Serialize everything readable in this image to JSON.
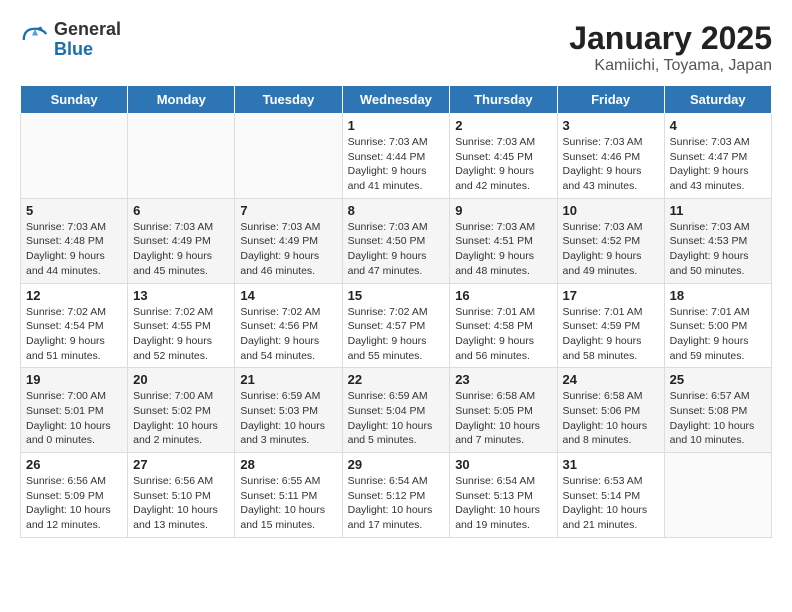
{
  "logo": {
    "general": "General",
    "blue": "Blue"
  },
  "title": "January 2025",
  "subtitle": "Kamiichi, Toyama, Japan",
  "weekdays": [
    "Sunday",
    "Monday",
    "Tuesday",
    "Wednesday",
    "Thursday",
    "Friday",
    "Saturday"
  ],
  "weeks": [
    [
      {
        "day": "",
        "info": ""
      },
      {
        "day": "",
        "info": ""
      },
      {
        "day": "",
        "info": ""
      },
      {
        "day": "1",
        "info": "Sunrise: 7:03 AM\nSunset: 4:44 PM\nDaylight: 9 hours and 41 minutes."
      },
      {
        "day": "2",
        "info": "Sunrise: 7:03 AM\nSunset: 4:45 PM\nDaylight: 9 hours and 42 minutes."
      },
      {
        "day": "3",
        "info": "Sunrise: 7:03 AM\nSunset: 4:46 PM\nDaylight: 9 hours and 43 minutes."
      },
      {
        "day": "4",
        "info": "Sunrise: 7:03 AM\nSunset: 4:47 PM\nDaylight: 9 hours and 43 minutes."
      }
    ],
    [
      {
        "day": "5",
        "info": "Sunrise: 7:03 AM\nSunset: 4:48 PM\nDaylight: 9 hours and 44 minutes."
      },
      {
        "day": "6",
        "info": "Sunrise: 7:03 AM\nSunset: 4:49 PM\nDaylight: 9 hours and 45 minutes."
      },
      {
        "day": "7",
        "info": "Sunrise: 7:03 AM\nSunset: 4:49 PM\nDaylight: 9 hours and 46 minutes."
      },
      {
        "day": "8",
        "info": "Sunrise: 7:03 AM\nSunset: 4:50 PM\nDaylight: 9 hours and 47 minutes."
      },
      {
        "day": "9",
        "info": "Sunrise: 7:03 AM\nSunset: 4:51 PM\nDaylight: 9 hours and 48 minutes."
      },
      {
        "day": "10",
        "info": "Sunrise: 7:03 AM\nSunset: 4:52 PM\nDaylight: 9 hours and 49 minutes."
      },
      {
        "day": "11",
        "info": "Sunrise: 7:03 AM\nSunset: 4:53 PM\nDaylight: 9 hours and 50 minutes."
      }
    ],
    [
      {
        "day": "12",
        "info": "Sunrise: 7:02 AM\nSunset: 4:54 PM\nDaylight: 9 hours and 51 minutes."
      },
      {
        "day": "13",
        "info": "Sunrise: 7:02 AM\nSunset: 4:55 PM\nDaylight: 9 hours and 52 minutes."
      },
      {
        "day": "14",
        "info": "Sunrise: 7:02 AM\nSunset: 4:56 PM\nDaylight: 9 hours and 54 minutes."
      },
      {
        "day": "15",
        "info": "Sunrise: 7:02 AM\nSunset: 4:57 PM\nDaylight: 9 hours and 55 minutes."
      },
      {
        "day": "16",
        "info": "Sunrise: 7:01 AM\nSunset: 4:58 PM\nDaylight: 9 hours and 56 minutes."
      },
      {
        "day": "17",
        "info": "Sunrise: 7:01 AM\nSunset: 4:59 PM\nDaylight: 9 hours and 58 minutes."
      },
      {
        "day": "18",
        "info": "Sunrise: 7:01 AM\nSunset: 5:00 PM\nDaylight: 9 hours and 59 minutes."
      }
    ],
    [
      {
        "day": "19",
        "info": "Sunrise: 7:00 AM\nSunset: 5:01 PM\nDaylight: 10 hours and 0 minutes."
      },
      {
        "day": "20",
        "info": "Sunrise: 7:00 AM\nSunset: 5:02 PM\nDaylight: 10 hours and 2 minutes."
      },
      {
        "day": "21",
        "info": "Sunrise: 6:59 AM\nSunset: 5:03 PM\nDaylight: 10 hours and 3 minutes."
      },
      {
        "day": "22",
        "info": "Sunrise: 6:59 AM\nSunset: 5:04 PM\nDaylight: 10 hours and 5 minutes."
      },
      {
        "day": "23",
        "info": "Sunrise: 6:58 AM\nSunset: 5:05 PM\nDaylight: 10 hours and 7 minutes."
      },
      {
        "day": "24",
        "info": "Sunrise: 6:58 AM\nSunset: 5:06 PM\nDaylight: 10 hours and 8 minutes."
      },
      {
        "day": "25",
        "info": "Sunrise: 6:57 AM\nSunset: 5:08 PM\nDaylight: 10 hours and 10 minutes."
      }
    ],
    [
      {
        "day": "26",
        "info": "Sunrise: 6:56 AM\nSunset: 5:09 PM\nDaylight: 10 hours and 12 minutes."
      },
      {
        "day": "27",
        "info": "Sunrise: 6:56 AM\nSunset: 5:10 PM\nDaylight: 10 hours and 13 minutes."
      },
      {
        "day": "28",
        "info": "Sunrise: 6:55 AM\nSunset: 5:11 PM\nDaylight: 10 hours and 15 minutes."
      },
      {
        "day": "29",
        "info": "Sunrise: 6:54 AM\nSunset: 5:12 PM\nDaylight: 10 hours and 17 minutes."
      },
      {
        "day": "30",
        "info": "Sunrise: 6:54 AM\nSunset: 5:13 PM\nDaylight: 10 hours and 19 minutes."
      },
      {
        "day": "31",
        "info": "Sunrise: 6:53 AM\nSunset: 5:14 PM\nDaylight: 10 hours and 21 minutes."
      },
      {
        "day": "",
        "info": ""
      }
    ]
  ]
}
